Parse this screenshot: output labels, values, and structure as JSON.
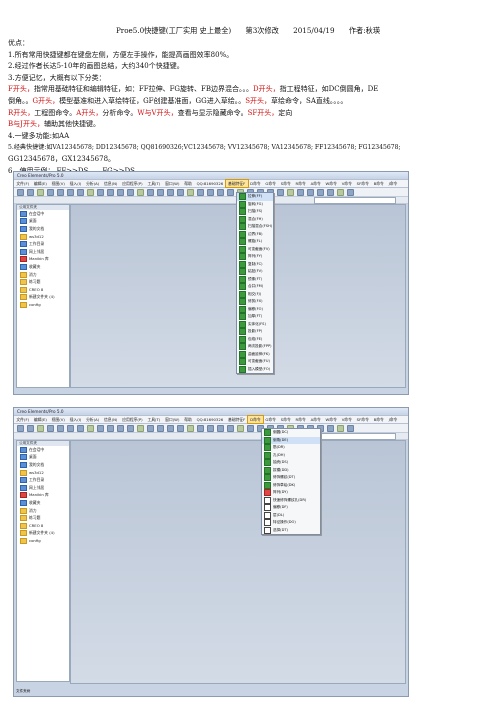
{
  "doc": {
    "title_main": "Proe5.0快捷键(工厂实用 史上最全)",
    "title_rev": "第3次修改",
    "title_date": "2015/04/19",
    "title_author": "作者:秋瑛",
    "l1": "优点：",
    "l2": "1.所有常用快捷键都在键盘左侧，方便左手操作，能提高画图效率80%。",
    "l3": "2.经过作者长达5-10年的画图总结，大约340个快捷键。",
    "l4": "3.方便记忆，大概有以下分类：",
    "l5a": "F开头，",
    "l5b": "指常用基础特征和编辑特征，如：FF拉伸、FG旋转、FB边界混合。。。",
    "l5c": "D开头，",
    "l5d": "指工程特征，如DC倒圆角，DE",
    "l6a": "倒角。。",
    "l6b": "G开头，",
    "l6c": "模型基准和进入草绘特征，GF创建基准面，GG进入草绘。。",
    "l6d": "S开头，",
    "l6e": "草绘命令，SA直线。。。。",
    "l7a": "R开头，",
    "l7b": "工程图命令。",
    "l7c": "A开头，",
    "l7d": "分析命令。",
    "l7e": "W与V开头，",
    "l7f": "查看与显示隐藏命令。",
    "l7g": "SF开头，",
    "l7h": "定向",
    "l8a": "B与J开头，",
    "l8b": "辅助其他快捷键。",
    "l9": "4.一键多功能:如AA",
    "l10": "5.经典快捷键:如VA12345678; DD12345678; QQ81690326;VC12345678; VV12345678; VA12345678; FF12345678; FG12345678;",
    "l11": "GG12345678，GX12345678。",
    "l12a": "6、使用示例：",
    "l12b": "FF>>DS",
    "l12c": "FG>>DS"
  },
  "ui": {
    "app_title": "Creo Elements/Pro 5.0",
    "menus": [
      "文件(F)",
      "编辑(E)",
      "视图(V)",
      "插入(I)",
      "分析(A)",
      "信息(N)",
      "应用程序(P)",
      "工具(T)",
      "窗口(W)",
      "帮助",
      "QQ:81690326",
      "基础特征F",
      "D命令",
      "G命令",
      "S命令",
      "R命令",
      "A命令",
      "W命令",
      "V命令",
      "SF命令",
      "B命令",
      "J命令"
    ],
    "nav_header": "公用文件夹",
    "nav_items": [
      "在会话中",
      "桌面",
      "我的文档",
      "ws3d12",
      "工作目录",
      "网上邻居",
      "Manikin 库",
      "收藏夹",
      "消力",
      "练习题",
      "CREO 8",
      "新建文件夹 (4)",
      "config"
    ],
    "menu1_items": [
      "拉伸(FF)",
      "旋转(FG)",
      "扫描(FS)",
      "混合(FH)",
      "扫描混合(FSH)",
      "边界(FB)",
      "螺旋(FL)",
      "可变截面(FV)",
      "阵列(FY)",
      "复制(FC)",
      "粘贴(FV)",
      "镜像(FT)",
      "合并(FM)",
      "相交(FJ)",
      "修剪(FX)",
      "偏移(FO)",
      "加厚(FT)",
      "实体化(FS)",
      "投影(FP)",
      "包络(FE)",
      "两次投影(FPP)",
      "曲面延伸(FK)",
      "可变截面(FU)",
      "插入模型(FO)"
    ],
    "menu2_items": [
      "倒圆(DC)",
      "倒角(DE)",
      "筋(DR)",
      "孔(DH)",
      "抽壳(DS)",
      "拔模(DD)",
      "修饰螺纹(DT)",
      "修饰草绘(DK)",
      "阵列(DY)",
      "快速修饰螺纹孔(DR)",
      "偏移(DF)",
      "层(DL)",
      "特征操作(DO)",
      "选择(DT)"
    ],
    "status_tab": "文件夹树"
  }
}
